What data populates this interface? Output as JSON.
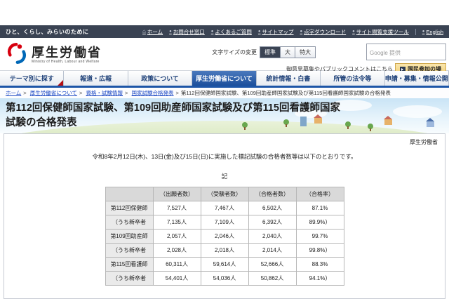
{
  "utility_bar": {
    "tagline": "ひと、くらし、みらいのために",
    "links": [
      {
        "label": "ホーム",
        "icon": "home-icon"
      },
      {
        "label": "お問合せ窓口",
        "icon": "arrow-circle-icon"
      },
      {
        "label": "よくあるご質問",
        "icon": "arrow-circle-icon"
      },
      {
        "label": "サイトマップ",
        "icon": "arrow-circle-icon"
      },
      {
        "label": "点字ダウンロード",
        "icon": "arrow-circle-icon"
      },
      {
        "label": "サイト閲覧支援ツール",
        "icon": "arrow-circle-icon"
      },
      {
        "label": "English",
        "icon": "arrow-circle-icon",
        "divider": true
      }
    ]
  },
  "header": {
    "logo_title": "厚生労働省",
    "logo_subtitle": "Ministry of Health, Labour and Welfare",
    "font_size": {
      "label": "文字サイズの変更",
      "options": [
        {
          "label": "標準",
          "selected": true
        },
        {
          "label": "大"
        },
        {
          "label": "特大"
        }
      ]
    },
    "search": {
      "provider": "Google 提供"
    },
    "comment_text": "御意見募集やパブリックコメントはこちら",
    "participation_button": "国民参加の場"
  },
  "nav": {
    "tabs": [
      {
        "label": "テーマ別に探す",
        "fold": true
      },
      {
        "label": "報道・広報"
      },
      {
        "label": "政策について"
      },
      {
        "label": "厚生労働省について",
        "active": true
      },
      {
        "label": "統計情報・白書"
      },
      {
        "label": "所管の法令等"
      },
      {
        "label": "申請・募集・情報公開"
      }
    ]
  },
  "breadcrumb": {
    "items": [
      "ホーム",
      "厚生労働省について",
      "資格・試験情報",
      "国家試験合格発表"
    ],
    "current": "第112回保健師国家試験、第109回助産師国家試験及び第115回看護師国家試験の合格発表",
    "separator": ">"
  },
  "page": {
    "title": "第112回保健師国家試験、第109回助産師国家試験及び第115回看護師国家試験の合格発表"
  },
  "content": {
    "agency": "厚生労働省",
    "intro": "令和8年2月12日(木)、13日(金)及び15日(日)に実施した標記試験の合格者数等は以下のとおりです。",
    "note_heading": "記",
    "results_table": {
      "headers": [
        "",
        "（出願者数）",
        "（受験者数）",
        "（合格者数）",
        "（合格率）"
      ],
      "rows": [
        [
          "第112回保健師",
          "7,527人",
          "7,467人",
          "6,502人",
          "87.1%"
        ],
        [
          "（うち新卒者",
          "7,135人",
          "7,109人",
          "6,392人",
          "89.9%）"
        ],
        [
          "第109回助産師",
          "2,057人",
          "2,046人",
          "2,040人",
          "99.7%"
        ],
        [
          "（うち新卒者",
          "2,028人",
          "2,018人",
          "2,014人",
          "99.8%）"
        ],
        [
          "第115回看護師",
          "60,311人",
          "59,614人",
          "52,666人",
          "88.3%"
        ],
        [
          "（うち新卒者",
          "54,401人",
          "54,036人",
          "50,862人",
          "94.1%）"
        ]
      ]
    }
  },
  "colors": {
    "accent_blue": "#1d55a7",
    "bar_navy": "#3a4353",
    "brand_red": "#d7000f",
    "brand_blue": "#0068b7",
    "participation_gold": "#f0cf76"
  }
}
